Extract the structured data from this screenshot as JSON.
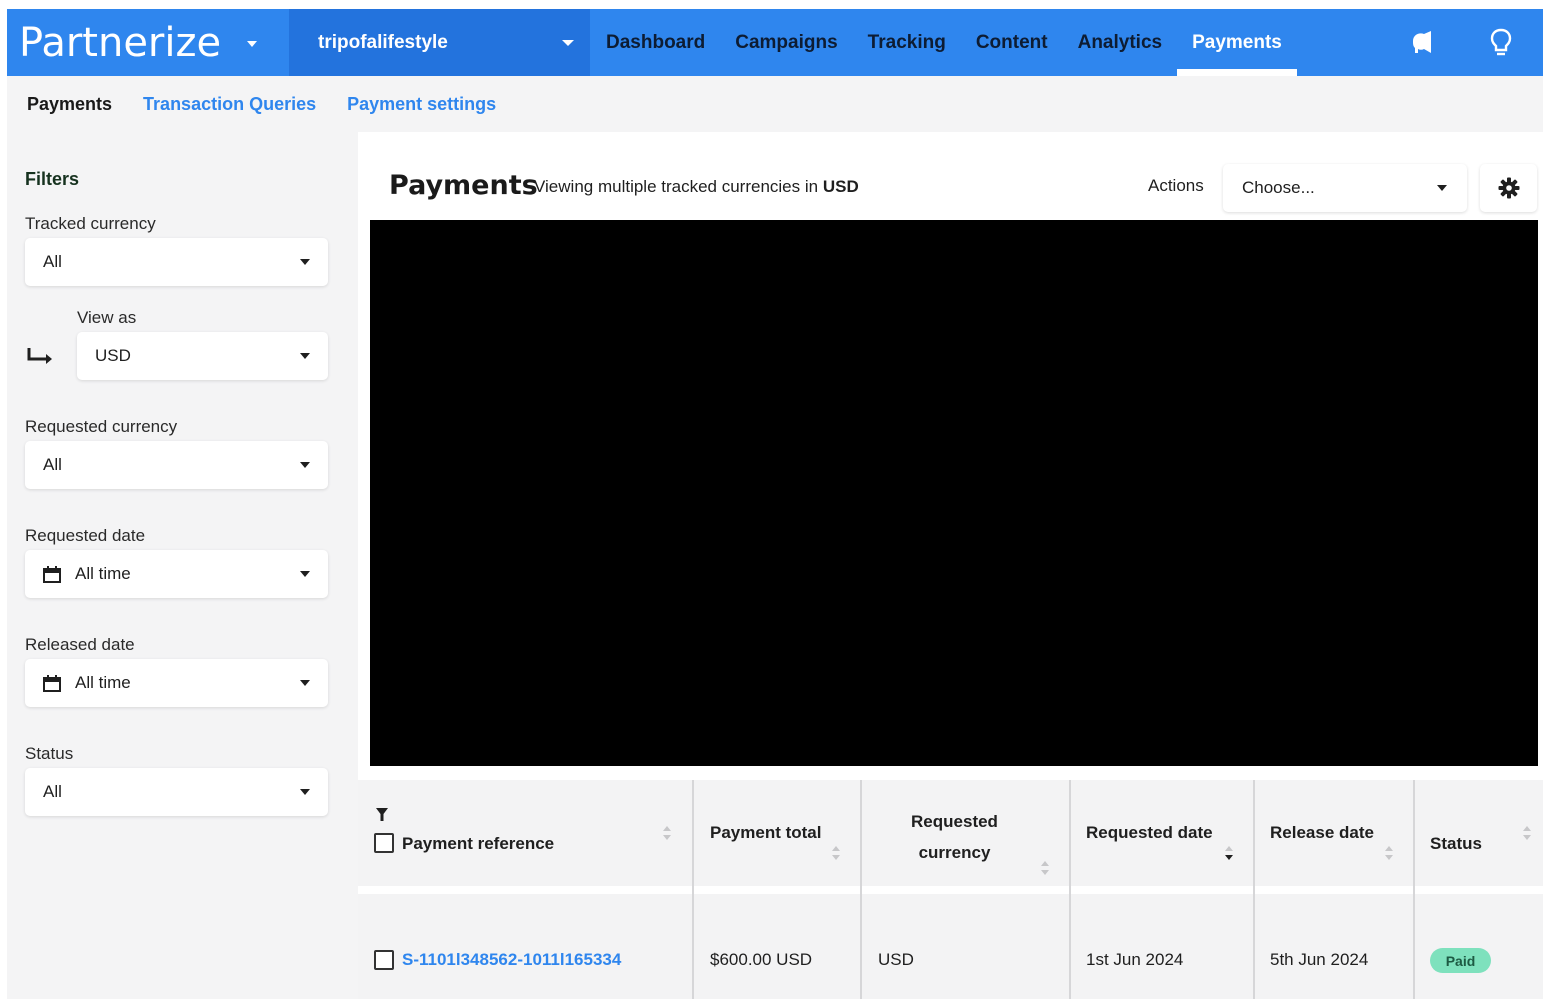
{
  "brand": {
    "name": "Partnerize"
  },
  "account": {
    "name": "tripofalifestyle"
  },
  "nav": {
    "items": [
      "Dashboard",
      "Campaigns",
      "Tracking",
      "Content",
      "Analytics",
      "Payments"
    ],
    "active": "Payments",
    "icons": [
      "announcement-icon",
      "lightbulb-icon"
    ]
  },
  "subnav": {
    "items": [
      "Payments",
      "Transaction Queries",
      "Payment settings"
    ],
    "current": "Payments"
  },
  "filters": {
    "title": "Filters",
    "tracked_currency": {
      "label": "Tracked currency",
      "value": "All"
    },
    "view_as": {
      "label": "View as",
      "value": "USD"
    },
    "requested_currency": {
      "label": "Requested currency",
      "value": "All"
    },
    "requested_date": {
      "label": "Requested date",
      "value": "All time"
    },
    "released_date": {
      "label": "Released date",
      "value": "All time"
    },
    "status": {
      "label": "Status",
      "value": "All"
    }
  },
  "main": {
    "title": "Payments",
    "subtitle_prefix": "Viewing multiple tracked currencies in",
    "subtitle_currency": "USD",
    "actions_label": "Actions",
    "actions_value": "Choose..."
  },
  "table": {
    "headers": {
      "payment_reference": "Payment reference",
      "payment_total": "Payment total",
      "requested_currency_1": "Requested",
      "requested_currency_2": "currency",
      "requested_date": "Requested date",
      "release_date": "Release date",
      "status": "Status"
    },
    "rows": [
      {
        "payment_reference": "S-1101l348562-1011l165334",
        "payment_total": "$600.00 USD",
        "requested_currency": "USD",
        "requested_date": "1st Jun 2024",
        "release_date": "5th Jun 2024",
        "status": "Paid"
      }
    ]
  },
  "colors": {
    "nav_bg": "#2f86ee",
    "account_bg": "#2373dd",
    "link": "#2f86ee",
    "paid_badge": "#7ee1bd",
    "panel_bg": "#f4f4f5"
  }
}
